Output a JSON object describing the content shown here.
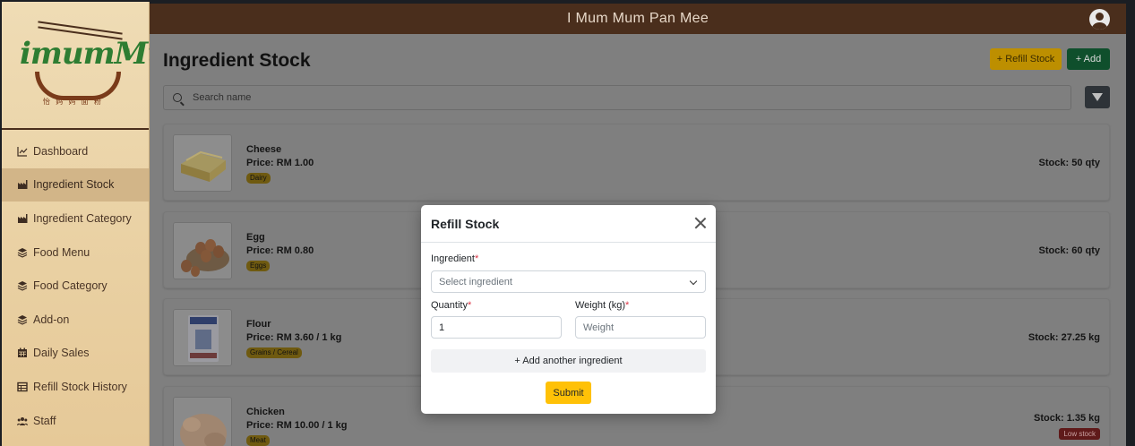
{
  "app": {
    "title": "I Mum Mum Pan Mee"
  },
  "logo": {
    "brand": "imumMum",
    "subtitle": "怡 妈 妈 面 粉"
  },
  "sidebar": {
    "items": [
      {
        "label": "Dashboard",
        "icon": "chart-line-icon"
      },
      {
        "label": "Ingredient Stock",
        "icon": "industry-icon",
        "active": true
      },
      {
        "label": "Ingredient Category",
        "icon": "industry-icon"
      },
      {
        "label": "Food Menu",
        "icon": "layers-icon"
      },
      {
        "label": "Food Category",
        "icon": "layers-icon"
      },
      {
        "label": "Add-on",
        "icon": "layers-icon"
      },
      {
        "label": "Daily Sales",
        "icon": "calendar-icon"
      },
      {
        "label": "Refill Stock History",
        "icon": "table-icon"
      },
      {
        "label": "Staff",
        "icon": "users-icon"
      }
    ]
  },
  "page": {
    "title": "Ingredient Stock",
    "refill_label": "+ Refill Stock",
    "add_label": "+ Add",
    "search_placeholder": "Search name"
  },
  "ingredients": [
    {
      "name": "Cheese",
      "price": "Price: RM 1.00",
      "category": "Dairy",
      "stock": "Stock: 50 qty",
      "low_stock": ""
    },
    {
      "name": "Egg",
      "price": "Price: RM 0.80",
      "category": "Eggs",
      "stock": "Stock: 60 qty",
      "low_stock": ""
    },
    {
      "name": "Flour",
      "price": "Price: RM 3.60 / 1 kg",
      "category": "Grains / Cereal",
      "stock": "Stock: 27.25 kg",
      "low_stock": ""
    },
    {
      "name": "Chicken",
      "price": "Price: RM 10.00 / 1 kg",
      "category": "Meat",
      "stock": "Stock: 1.35 kg",
      "low_stock": "Low stock"
    }
  ],
  "modal": {
    "title": "Refill Stock",
    "ingredient_label": "Ingredient",
    "ingredient_placeholder": "Select ingredient",
    "quantity_label": "Quantity",
    "quantity_value": "1",
    "weight_label": "Weight (kg)",
    "weight_placeholder": "Weight",
    "add_another_label": "+ Add another ingredient",
    "submit_label": "Submit",
    "required_mark": "*"
  },
  "colors": {
    "topbar": "#4a2e1c",
    "refill_button": "#ffc107",
    "add_button": "#198754",
    "low_stock": "#dc3545"
  }
}
